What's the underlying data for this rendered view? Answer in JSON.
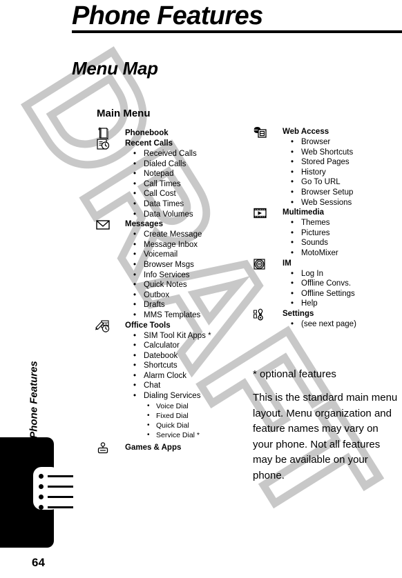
{
  "document": {
    "title": "Phone Features",
    "section_title": "Menu Map",
    "page_number": "64",
    "side_tab_label": "Phone Features",
    "watermark": "DRAFT"
  },
  "main_menu": {
    "label": "Main Menu",
    "left_column": [
      {
        "name": "Phonebook",
        "icon": "phonebook-icon",
        "items": []
      },
      {
        "name": "Recent Calls",
        "icon": "recent-calls-icon",
        "items": [
          "Received Calls",
          "Dialed Calls",
          "Notepad",
          "Call Times",
          "Call Cost",
          "Data Times",
          "Data Volumes"
        ]
      },
      {
        "name": "Messages",
        "icon": "envelope-icon",
        "items": [
          "Create Message",
          "Message Inbox",
          "Voicemail",
          "Browser Msgs",
          "Info Services",
          "Quick Notes",
          "Outbox",
          "Drafts",
          "MMS Templates"
        ]
      },
      {
        "name": "Office Tools",
        "icon": "office-tools-icon",
        "items": [
          "SIM Tool Kit Apps *",
          "Calculator",
          "Datebook",
          "Shortcuts",
          "Alarm Clock",
          "Chat",
          "Dialing Services"
        ],
        "sub_items": [
          "Voice Dial",
          "Fixed Dial",
          "Quick Dial",
          "Service Dial *"
        ]
      },
      {
        "name": "Games & Apps",
        "icon": "joystick-icon",
        "items": []
      }
    ],
    "right_column": [
      {
        "name": "Web Access",
        "icon": "globe-page-icon",
        "items": [
          "Browser",
          "Web Shortcuts",
          "Stored Pages",
          "History",
          "Go To URL",
          "Browser Setup",
          "Web Sessions"
        ]
      },
      {
        "name": "Multimedia",
        "icon": "film-strip-icon",
        "items": [
          "Themes",
          "Pictures",
          "Sounds",
          "MotoMixer"
        ]
      },
      {
        "name": "IM",
        "icon": "chat-bubble-icon",
        "items": [
          "Log In",
          "Offline Convs.",
          "Offline Settings",
          "Help"
        ]
      },
      {
        "name": "Settings",
        "icon": "wrench-icon",
        "items": [
          "(see next page)"
        ]
      }
    ]
  },
  "notes": {
    "optional": "* optional features",
    "body": "This is the standard main menu layout. Menu organization and feature names may vary on your phone. Not all features may be available on your phone."
  },
  "bullet": "•"
}
